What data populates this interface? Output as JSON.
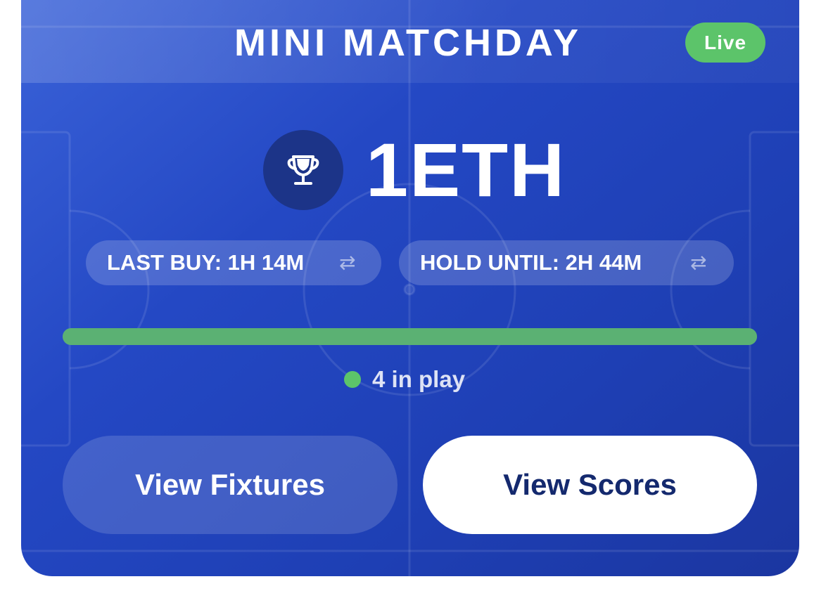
{
  "card": {
    "title": "MINI MATCHDAY",
    "status_badge": "Live",
    "prize": "1ETH",
    "trophy_icon": "trophy-icon",
    "last_buy": "LAST BUY: 1H 14M",
    "hold_until": "HOLD UNTIL: 2H 44M",
    "swap_icon": "⇄",
    "progress": 1.0,
    "in_play": "4 in play",
    "buttons": {
      "fixtures": "View Fixtures",
      "scores": "View Scores"
    }
  },
  "colors": {
    "background_top": "#3a62d8",
    "background_bottom": "#1b36a0",
    "live_green": "#5cc46a",
    "progress_green": "#5bb173",
    "trophy_circle": "#1c3488",
    "scores_text": "#14296e"
  }
}
